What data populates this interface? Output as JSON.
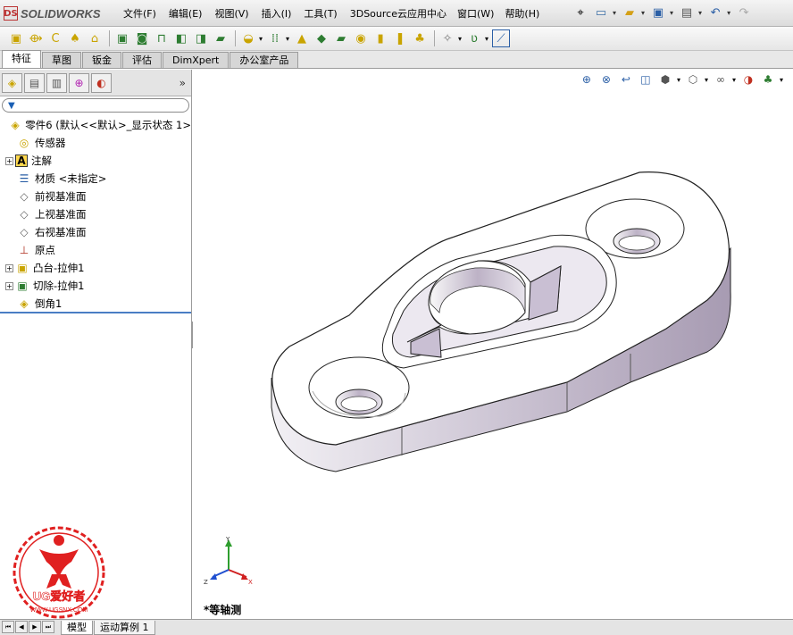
{
  "app": {
    "logo_text": "SOLIDWORKS",
    "logo_mark": "DS"
  },
  "menu": [
    "文件(F)",
    "编辑(E)",
    "视图(V)",
    "插入(I)",
    "工具(T)",
    "3DSource云应用中心",
    "窗口(W)",
    "帮助(H)"
  ],
  "quick_access": [
    {
      "name": "pin-icon",
      "glyph": "⌖"
    },
    {
      "name": "new-document-icon",
      "glyph": "🗋"
    },
    {
      "name": "open-icon",
      "glyph": "📂"
    },
    {
      "name": "save-icon",
      "glyph": "💾"
    },
    {
      "name": "print-icon",
      "glyph": "🖶"
    },
    {
      "name": "undo-icon",
      "glyph": "↶"
    },
    {
      "name": "redo-icon",
      "glyph": "↷"
    }
  ],
  "feature_tabs": [
    "特征",
    "草图",
    "钣金",
    "评估",
    "DimXpert",
    "办公室产品"
  ],
  "feature_tree": {
    "root": "零件6  (默认<<默认>_显示状态 1>",
    "items": [
      {
        "label": "传感器",
        "icon": "sensor-icon",
        "glyph": "◎",
        "expandable": false
      },
      {
        "label": "注解",
        "icon": "annotation-icon",
        "glyph": "A",
        "expandable": true
      },
      {
        "label": "材质 <未指定>",
        "icon": "material-icon",
        "glyph": "☰",
        "expandable": false
      },
      {
        "label": "前视基准面",
        "icon": "plane-icon",
        "glyph": "◇",
        "expandable": false
      },
      {
        "label": "上视基准面",
        "icon": "plane-icon",
        "glyph": "◇",
        "expandable": false
      },
      {
        "label": "右视基准面",
        "icon": "plane-icon",
        "glyph": "◇",
        "expandable": false
      },
      {
        "label": "原点",
        "icon": "origin-icon",
        "glyph": "⊥",
        "expandable": false
      },
      {
        "label": "凸台-拉伸1",
        "icon": "boss-extrude-icon",
        "glyph": "▣",
        "expandable": true
      },
      {
        "label": "切除-拉伸1",
        "icon": "cut-extrude-icon",
        "glyph": "▣",
        "expandable": true
      },
      {
        "label": "倒角1",
        "icon": "chamfer-icon",
        "glyph": "◈",
        "expandable": false
      }
    ]
  },
  "view": {
    "orientation_label": "*等轴测",
    "triad": {
      "x": "X",
      "y": "Y",
      "z": "Z"
    }
  },
  "bottom_tabs": [
    "模型",
    "运动算例 1"
  ],
  "watermark": {
    "brand": "UG爱好者",
    "url": "WWW.UGSNX.COM"
  },
  "colors": {
    "accent": "#4a7ec4",
    "part_face": "#ffffff",
    "part_side": "#c8bfd0",
    "watermark": "#e02020"
  }
}
